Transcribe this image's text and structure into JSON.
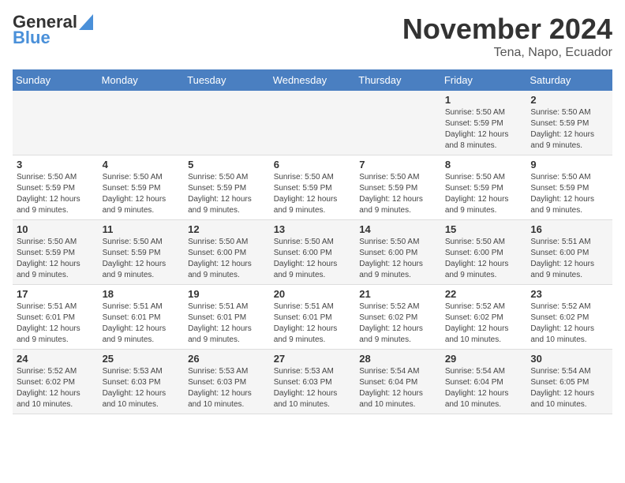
{
  "logo": {
    "text_general": "General",
    "text_blue": "Blue"
  },
  "header": {
    "month_title": "November 2024",
    "location": "Tena, Napo, Ecuador"
  },
  "weekdays": [
    "Sunday",
    "Monday",
    "Tuesday",
    "Wednesday",
    "Thursday",
    "Friday",
    "Saturday"
  ],
  "weeks": [
    [
      {
        "day": "",
        "info": ""
      },
      {
        "day": "",
        "info": ""
      },
      {
        "day": "",
        "info": ""
      },
      {
        "day": "",
        "info": ""
      },
      {
        "day": "",
        "info": ""
      },
      {
        "day": "1",
        "info": "Sunrise: 5:50 AM\nSunset: 5:59 PM\nDaylight: 12 hours\nand 8 minutes."
      },
      {
        "day": "2",
        "info": "Sunrise: 5:50 AM\nSunset: 5:59 PM\nDaylight: 12 hours\nand 9 minutes."
      }
    ],
    [
      {
        "day": "3",
        "info": "Sunrise: 5:50 AM\nSunset: 5:59 PM\nDaylight: 12 hours\nand 9 minutes."
      },
      {
        "day": "4",
        "info": "Sunrise: 5:50 AM\nSunset: 5:59 PM\nDaylight: 12 hours\nand 9 minutes."
      },
      {
        "day": "5",
        "info": "Sunrise: 5:50 AM\nSunset: 5:59 PM\nDaylight: 12 hours\nand 9 minutes."
      },
      {
        "day": "6",
        "info": "Sunrise: 5:50 AM\nSunset: 5:59 PM\nDaylight: 12 hours\nand 9 minutes."
      },
      {
        "day": "7",
        "info": "Sunrise: 5:50 AM\nSunset: 5:59 PM\nDaylight: 12 hours\nand 9 minutes."
      },
      {
        "day": "8",
        "info": "Sunrise: 5:50 AM\nSunset: 5:59 PM\nDaylight: 12 hours\nand 9 minutes."
      },
      {
        "day": "9",
        "info": "Sunrise: 5:50 AM\nSunset: 5:59 PM\nDaylight: 12 hours\nand 9 minutes."
      }
    ],
    [
      {
        "day": "10",
        "info": "Sunrise: 5:50 AM\nSunset: 5:59 PM\nDaylight: 12 hours\nand 9 minutes."
      },
      {
        "day": "11",
        "info": "Sunrise: 5:50 AM\nSunset: 5:59 PM\nDaylight: 12 hours\nand 9 minutes."
      },
      {
        "day": "12",
        "info": "Sunrise: 5:50 AM\nSunset: 6:00 PM\nDaylight: 12 hours\nand 9 minutes."
      },
      {
        "day": "13",
        "info": "Sunrise: 5:50 AM\nSunset: 6:00 PM\nDaylight: 12 hours\nand 9 minutes."
      },
      {
        "day": "14",
        "info": "Sunrise: 5:50 AM\nSunset: 6:00 PM\nDaylight: 12 hours\nand 9 minutes."
      },
      {
        "day": "15",
        "info": "Sunrise: 5:50 AM\nSunset: 6:00 PM\nDaylight: 12 hours\nand 9 minutes."
      },
      {
        "day": "16",
        "info": "Sunrise: 5:51 AM\nSunset: 6:00 PM\nDaylight: 12 hours\nand 9 minutes."
      }
    ],
    [
      {
        "day": "17",
        "info": "Sunrise: 5:51 AM\nSunset: 6:01 PM\nDaylight: 12 hours\nand 9 minutes."
      },
      {
        "day": "18",
        "info": "Sunrise: 5:51 AM\nSunset: 6:01 PM\nDaylight: 12 hours\nand 9 minutes."
      },
      {
        "day": "19",
        "info": "Sunrise: 5:51 AM\nSunset: 6:01 PM\nDaylight: 12 hours\nand 9 minutes."
      },
      {
        "day": "20",
        "info": "Sunrise: 5:51 AM\nSunset: 6:01 PM\nDaylight: 12 hours\nand 9 minutes."
      },
      {
        "day": "21",
        "info": "Sunrise: 5:52 AM\nSunset: 6:02 PM\nDaylight: 12 hours\nand 9 minutes."
      },
      {
        "day": "22",
        "info": "Sunrise: 5:52 AM\nSunset: 6:02 PM\nDaylight: 12 hours\nand 10 minutes."
      },
      {
        "day": "23",
        "info": "Sunrise: 5:52 AM\nSunset: 6:02 PM\nDaylight: 12 hours\nand 10 minutes."
      }
    ],
    [
      {
        "day": "24",
        "info": "Sunrise: 5:52 AM\nSunset: 6:02 PM\nDaylight: 12 hours\nand 10 minutes."
      },
      {
        "day": "25",
        "info": "Sunrise: 5:53 AM\nSunset: 6:03 PM\nDaylight: 12 hours\nand 10 minutes."
      },
      {
        "day": "26",
        "info": "Sunrise: 5:53 AM\nSunset: 6:03 PM\nDaylight: 12 hours\nand 10 minutes."
      },
      {
        "day": "27",
        "info": "Sunrise: 5:53 AM\nSunset: 6:03 PM\nDaylight: 12 hours\nand 10 minutes."
      },
      {
        "day": "28",
        "info": "Sunrise: 5:54 AM\nSunset: 6:04 PM\nDaylight: 12 hours\nand 10 minutes."
      },
      {
        "day": "29",
        "info": "Sunrise: 5:54 AM\nSunset: 6:04 PM\nDaylight: 12 hours\nand 10 minutes."
      },
      {
        "day": "30",
        "info": "Sunrise: 5:54 AM\nSunset: 6:05 PM\nDaylight: 12 hours\nand 10 minutes."
      }
    ]
  ]
}
